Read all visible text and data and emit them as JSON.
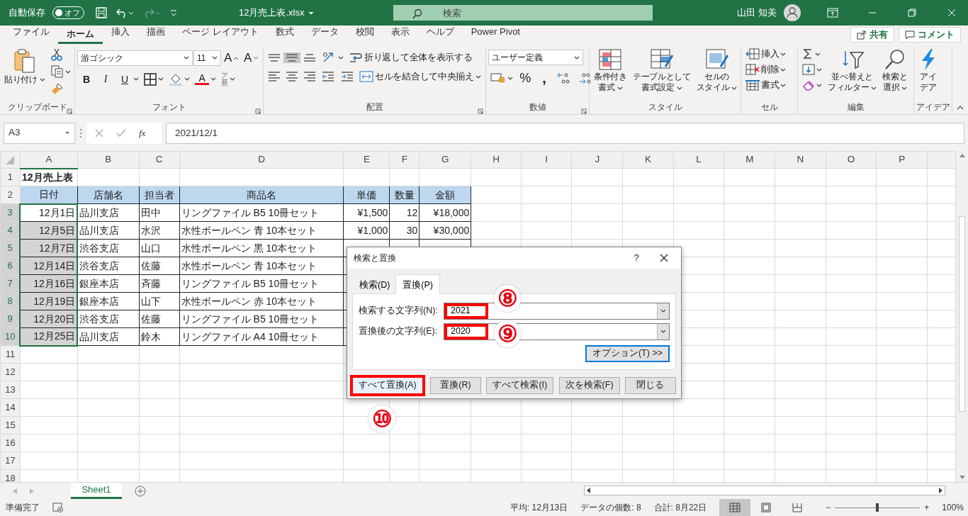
{
  "title_bar": {
    "autosave_label": "自動保存",
    "autosave": {
      "label": "オフ",
      "on": false
    },
    "redo_disabled": true,
    "filename": "12月売上表.xlsx",
    "search_placeholder": "検索",
    "user": "山田 知美"
  },
  "menu_tabs": [
    {
      "label": "ファイル",
      "selected": false
    },
    {
      "label": "ホーム",
      "selected": true
    },
    {
      "label": "挿入",
      "selected": false
    },
    {
      "label": "描画",
      "selected": false
    },
    {
      "label": "ページ レイアウト",
      "selected": false
    },
    {
      "label": "数式",
      "selected": false
    },
    {
      "label": "データ",
      "selected": false
    },
    {
      "label": "校閲",
      "selected": false
    },
    {
      "label": "表示",
      "selected": false
    },
    {
      "label": "ヘルプ",
      "selected": false
    },
    {
      "label": "Power Pivot",
      "selected": false
    }
  ],
  "share_button": "共有",
  "comment_button": "コメント",
  "ribbon": [
    {
      "title": "クリップボード",
      "launcher": true,
      "parts": [
        [
          {
            "kind": "large",
            "lines": [
              "貼り付け"
            ],
            "dropdown": true
          }
        ],
        [
          {
            "kind": "icon"
          },
          {
            "kind": "icon",
            "dropdown": true
          },
          {
            "kind": "icon"
          }
        ]
      ]
    },
    {
      "title": "フォント",
      "launcher": true,
      "parts": [
        [
          {
            "kind": "combo",
            "value": "游ゴシック"
          },
          {
            "kind": "combo",
            "value": "11"
          },
          {
            "kind": "fontsize",
            "label": "A"
          },
          {
            "kind": "fontsize",
            "label": "A"
          }
        ],
        [
          {
            "kind": "text",
            "label": "B"
          },
          {
            "kind": "text",
            "label": "I"
          },
          {
            "kind": "text",
            "label": "U",
            "dropdown": true
          },
          {
            "kind": "icon",
            "dropdown": true
          },
          {
            "kind": "icon",
            "dropdown": true
          },
          {
            "kind": "text",
            "label": "A",
            "dropdown": true
          },
          {
            "kind": "phonetic",
            "top": "ア",
            "bottom": "亜",
            "dropdown": true
          }
        ]
      ]
    },
    {
      "title": "配置",
      "launcher": true,
      "parts": [
        [
          {
            "kind": "icon",
            "selected": false
          },
          {
            "kind": "icon",
            "selected": true
          },
          {
            "kind": "icon",
            "selected": false
          },
          {
            "kind": "icon",
            "dropdown": true
          },
          {
            "kind": "small",
            "label": "折り返して全体を表示する"
          }
        ],
        [
          {
            "kind": "icon"
          },
          {
            "kind": "icon"
          },
          {
            "kind": "icon"
          },
          {
            "kind": "icon"
          },
          {
            "kind": "icon"
          },
          {
            "kind": "small",
            "label": "セルを結合して中央揃え",
            "dropdown": true
          }
        ]
      ]
    },
    {
      "title": "数値",
      "launcher": true,
      "parts": [
        [
          {
            "kind": "combo",
            "value": "ユーザー定義"
          }
        ],
        [
          {
            "kind": "icon",
            "dropdown": true
          },
          {
            "kind": "text",
            "label": "%"
          },
          {
            "kind": "text",
            "label": ","
          },
          {
            "kind": "icon"
          },
          {
            "kind": "icon"
          }
        ]
      ]
    },
    {
      "title": "スタイル",
      "parts": [
        [
          {
            "kind": "large",
            "lines": [
              "条件付き",
              "書式"
            ],
            "dropdown": true
          }
        ],
        [
          {
            "kind": "large",
            "lines": [
              "テーブルとして",
              "書式設定"
            ],
            "dropdown": true
          }
        ],
        [
          {
            "kind": "large",
            "lines": [
              "セルの",
              "スタイル"
            ],
            "dropdown": true
          }
        ]
      ]
    },
    {
      "title": "セル",
      "parts": [
        [
          {
            "kind": "small",
            "label": "挿入",
            "dropdown": true
          },
          {
            "kind": "small",
            "label": "削除",
            "dropdown": true
          },
          {
            "kind": "small",
            "label": "書式",
            "dropdown": true
          }
        ]
      ]
    },
    {
      "title": "編集",
      "parts": [
        [
          {
            "kind": "icon",
            "dropdown": true
          },
          {
            "kind": "icon",
            "dropdown": true
          },
          {
            "kind": "icon",
            "dropdown": true
          }
        ],
        [
          {
            "kind": "large",
            "lines": [
              "並べ替えと",
              "フィルター"
            ],
            "dropdown": true
          }
        ],
        [
          {
            "kind": "large",
            "lines": [
              "検索と",
              "選択"
            ],
            "dropdown": true
          }
        ]
      ]
    },
    {
      "title": "アイデア",
      "parts": [
        [
          {
            "kind": "large",
            "lines": [
              "アイ",
              "デア"
            ]
          }
        ]
      ]
    }
  ],
  "formula_bar": {
    "name_box": "A3",
    "fx": "fx",
    "value": "2021/12/1"
  },
  "columns": [
    {
      "label": "A",
      "selected": true
    },
    {
      "label": "B",
      "selected": false
    },
    {
      "label": "C",
      "selected": false
    },
    {
      "label": "D",
      "selected": false
    },
    {
      "label": "E",
      "selected": false
    },
    {
      "label": "F",
      "selected": false
    },
    {
      "label": "G",
      "selected": false
    },
    {
      "label": "H",
      "selected": false
    },
    {
      "label": "I",
      "selected": false
    },
    {
      "label": "J",
      "selected": false
    },
    {
      "label": "K",
      "selected": false
    },
    {
      "label": "L",
      "selected": false
    },
    {
      "label": "M",
      "selected": false
    },
    {
      "label": "N",
      "selected": false
    },
    {
      "label": "O",
      "selected": false
    },
    {
      "label": "P",
      "selected": false
    }
  ],
  "rows": [
    {
      "number": "1",
      "kind": "title",
      "selected": false,
      "cells": [
        "12月売上表"
      ]
    },
    {
      "number": "2",
      "kind": "header",
      "selected": false,
      "cells": [
        "日付",
        "店舗名",
        "担当者",
        "商品名",
        "単価",
        "数量",
        "金額"
      ]
    },
    {
      "number": "3",
      "kind": "data",
      "selected": true,
      "active_cell": true,
      "cells": [
        "12月1日",
        "品川支店",
        "田中",
        "リングファイル B5 10冊セット",
        "¥1,500",
        "12",
        "¥18,000"
      ]
    },
    {
      "number": "4",
      "kind": "data",
      "selected": true,
      "cells": [
        "12月5日",
        "品川支店",
        "水沢",
        "水性ボールペン 青 10本セット",
        "¥1,000",
        "30",
        "¥30,000"
      ]
    },
    {
      "number": "5",
      "kind": "data",
      "selected": true,
      "cells": [
        "12月7日",
        "渋谷支店",
        "山口",
        "水性ボールペン 黒 10本セット"
      ]
    },
    {
      "number": "6",
      "kind": "data",
      "selected": true,
      "cells": [
        "12月14日",
        "渋谷支店",
        "佐藤",
        "水性ボールペン 青 10本セット"
      ]
    },
    {
      "number": "7",
      "kind": "data",
      "selected": true,
      "cells": [
        "12月16日",
        "銀座本店",
        "斉藤",
        "リングファイル B5 10冊セット"
      ]
    },
    {
      "number": "8",
      "kind": "data",
      "selected": true,
      "cells": [
        "12月19日",
        "銀座本店",
        "山下",
        "水性ボールペン 赤 10本セット"
      ]
    },
    {
      "number": "9",
      "kind": "data",
      "selected": true,
      "cells": [
        "12月20日",
        "渋谷支店",
        "佐藤",
        "リングファイル B5 10冊セット"
      ]
    },
    {
      "number": "10",
      "kind": "data",
      "selected": true,
      "cells": [
        "12月25日",
        "品川支店",
        "鈴木",
        "リングファイル A4 10冊セット"
      ]
    },
    {
      "number": "11",
      "kind": "empty",
      "selected": false
    },
    {
      "number": "12",
      "kind": "empty",
      "selected": false
    },
    {
      "number": "13",
      "kind": "empty",
      "selected": false
    },
    {
      "number": "14",
      "kind": "empty",
      "selected": false
    },
    {
      "number": "15",
      "kind": "empty",
      "selected": false
    },
    {
      "number": "16",
      "kind": "empty",
      "selected": false
    },
    {
      "number": "17",
      "kind": "empty",
      "selected": false
    },
    {
      "number": "18",
      "kind": "empty",
      "selected": false
    }
  ],
  "dialog": {
    "title": "検索と置換",
    "help": "?",
    "tabs": [
      {
        "label": "検索(D)",
        "selected": false
      },
      {
        "label": "置換(P)",
        "selected": true
      }
    ],
    "fields": [
      {
        "label": "検索する文字列(N):",
        "value": "2021",
        "highlighted": true
      },
      {
        "label": "置換後の文字列(E):",
        "value": "2020",
        "highlighted": true
      }
    ],
    "options_button": {
      "label": "オプション(T) >>",
      "focused": true
    },
    "buttons": [
      {
        "label": "すべて置換(A)",
        "highlighted": true
      },
      {
        "label": "置換(R)",
        "highlighted": false
      },
      {
        "label": "すべて検索(I)",
        "highlighted": false
      },
      {
        "label": "次を検索(F)",
        "highlighted": false
      },
      {
        "label": "閉じる",
        "highlighted": false
      }
    ]
  },
  "annotations": [
    "⑧",
    "⑨",
    "⑩"
  ],
  "sheet_tabs": [
    {
      "label": "Sheet1",
      "selected": true
    }
  ],
  "status_bar": {
    "status": "準備完了",
    "stats": [
      "平均: 12月13日",
      "データの個数: 8",
      "合計: 8月22日"
    ],
    "views": [
      {
        "selected": true
      },
      {
        "selected": false
      },
      {
        "selected": false
      }
    ],
    "zoom_out": "−",
    "zoom_in": "+",
    "zoom": {
      "level": 0.5
    },
    "zoom_label": "100%"
  }
}
